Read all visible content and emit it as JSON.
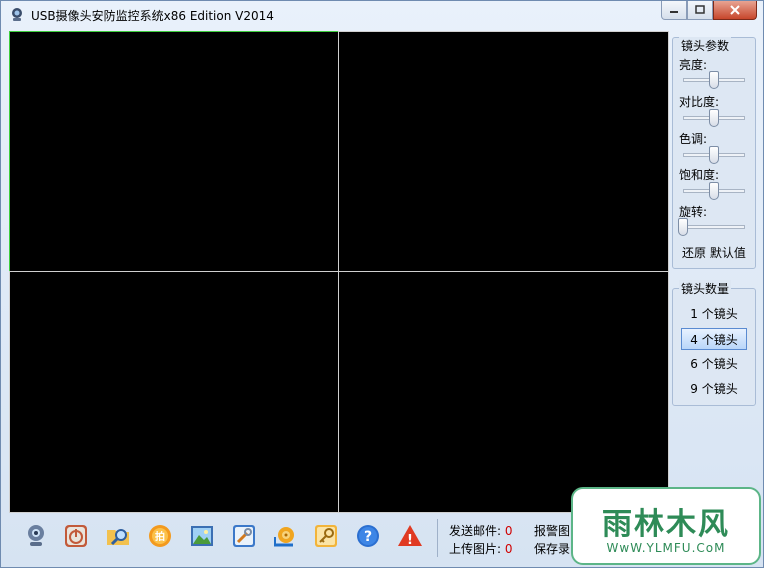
{
  "window": {
    "title": "USB摄像头安防监控系统x86 Edition V2014",
    "buttons": [
      "minimize",
      "maximize",
      "close"
    ]
  },
  "video_grid": {
    "layout": "2x2",
    "active_cell": 1,
    "background": "#000000",
    "active_border_color": "#3fcf3f"
  },
  "lens_params": {
    "title": "镜头参数",
    "sliders": [
      {
        "label": "亮度:",
        "value": 0.5
      },
      {
        "label": "对比度:",
        "value": 0.5
      },
      {
        "label": "色调:",
        "value": 0.5
      },
      {
        "label": "饱和度:",
        "value": 0.5
      },
      {
        "label": "旋转:",
        "value": 0.0
      }
    ],
    "reset_label": "还原 默认值"
  },
  "lens_count": {
    "title": "镜头数量",
    "options": [
      "1 个镜头",
      "4 个镜头",
      "6 个镜头",
      "9 个镜头"
    ],
    "selected": "4 个镜头"
  },
  "toolbar": {
    "icons": [
      "webcam-icon",
      "power-icon",
      "folder-search-icon",
      "photo-badge-icon",
      "picture-icon",
      "settings-wrench-icon",
      "snail-icon",
      "key-icon",
      "help-icon",
      "warning-icon"
    ]
  },
  "stats": {
    "email_label": "发送邮件:",
    "email_count": "0",
    "upload_label": "上传图片:",
    "upload_count": "0",
    "alarm_label": "报警图",
    "save_label": "保存录"
  },
  "watermark": {
    "logo": "雨林木风",
    "url": "WwW.YLMFU.CoM"
  }
}
